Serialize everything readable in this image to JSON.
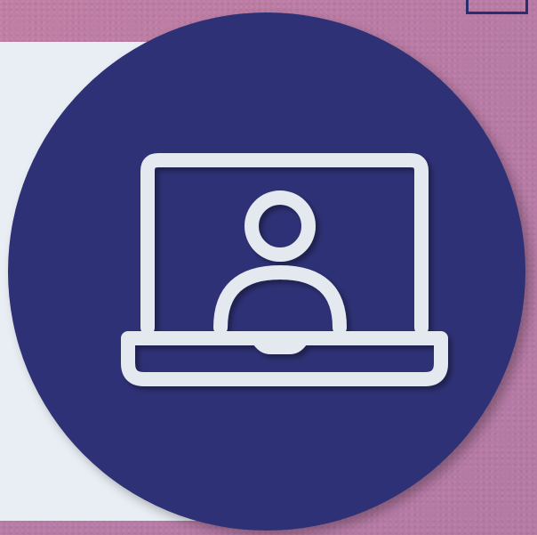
{
  "colors": {
    "background": "#bd7da5",
    "panel": "#e9eef4",
    "circle": "#2e3175",
    "icon": "#e4e8ef",
    "frame": "#2a2e6f"
  },
  "icons": {
    "main": "laptop-user-icon"
  }
}
